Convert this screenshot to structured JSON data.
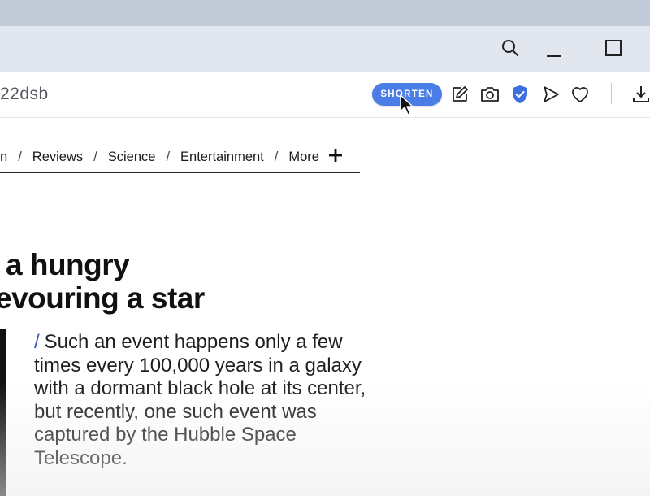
{
  "browser": {
    "address_text": "22dsb",
    "shorten_label": "SHORTEN",
    "accent_color": "#4a7de6",
    "titlebar_icons": [
      "search-icon",
      "minimize-icon",
      "maximize-icon"
    ],
    "toolbar_icons": [
      "edit-icon",
      "camera-icon",
      "shield-check-icon",
      "send-icon",
      "heart-icon",
      "download-icon"
    ]
  },
  "nav": {
    "items": [
      {
        "label": "n"
      },
      {
        "label": "Reviews"
      },
      {
        "label": "Science"
      },
      {
        "label": "Entertainment"
      },
      {
        "label": "More"
      }
    ],
    "separator": "/",
    "plus": "+"
  },
  "article": {
    "headline_line1": "a hungry",
    "headline_line2": "evouring a star",
    "slash": "/",
    "body": "Such an event happens only a few times every 100,000 years in a galaxy with a dormant black hole at its center, but recently, one such event was captured by the Hubble Space Telescope."
  }
}
